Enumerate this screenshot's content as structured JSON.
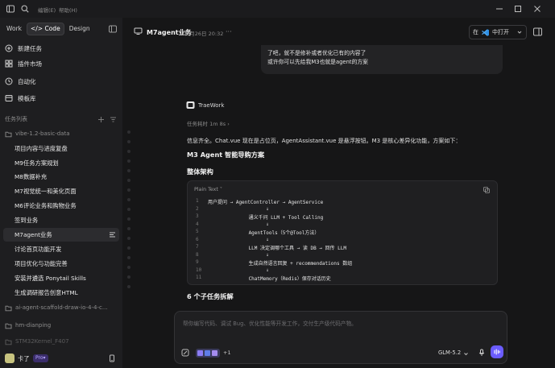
{
  "titlebar": {
    "menu_items": [
      "编辑(E)",
      "帮助(H)"
    ],
    "window_controls": [
      "minimize-icon",
      "maximize-icon",
      "close-icon"
    ]
  },
  "sidebar": {
    "modes": [
      {
        "label": "Work",
        "active": false
      },
      {
        "label": "</> Code",
        "active": true
      },
      {
        "label": "Design",
        "active": false
      }
    ],
    "nav": [
      {
        "label": "新建任务",
        "icon": "new-task-icon"
      },
      {
        "label": "插件市场",
        "icon": "plugin-icon"
      },
      {
        "label": "自动化",
        "icon": "automation-icon"
      },
      {
        "label": "模板库",
        "icon": "template-icon"
      }
    ],
    "section_label": "任务列表",
    "groups": [
      {
        "label": "vibe-1.2-basic-data"
      },
      {
        "label": "ai-agent-scaffold-draw-io-4-4-c..."
      },
      {
        "label": "hm-dianping"
      },
      {
        "label": "STM32Kernel_F407"
      }
    ],
    "tasks": [
      {
        "label": "项目内容与进度复盘",
        "active": false
      },
      {
        "label": "M9任务方案规划",
        "active": false
      },
      {
        "label": "M8数据补充",
        "active": false
      },
      {
        "label": "M7视觉统一和美化页面",
        "active": false
      },
      {
        "label": "M6评论业务和购物业务",
        "active": false
      },
      {
        "label": "签到业务",
        "active": false
      },
      {
        "label": "M7agent业务",
        "active": true
      },
      {
        "label": "讨论首页功能开发",
        "active": false
      },
      {
        "label": "项目优化与功能完善",
        "active": false
      },
      {
        "label": "安装并遴选 Ponytail Skills",
        "active": false
      },
      {
        "label": "生成调研报告创意HTML",
        "active": false
      }
    ],
    "user": {
      "name": "卡了",
      "badge": "Pro"
    }
  },
  "header": {
    "title": "M7agent业务",
    "date": "07月26日 20:32",
    "more": "···",
    "open_prefix": "在",
    "open_label": "中打开"
  },
  "chat": {
    "user_message_lines": [
      "了吧，就不是修补或者优化已有的内容了",
      "或许你可以先给我M3也就是agent的方案"
    ],
    "agent_name": "TraeWork",
    "task_time": "任务耗时 1m 8s ›",
    "intro": "信息齐全。Chat.vue 现在是占位页，AgentAssistant.vue 是悬浮按钮。M3 是核心差异化功能，方案如下：",
    "heading1": "M3 Agent 智能导购方案",
    "heading2": "整体架构",
    "code": {
      "lang": "Plain Text ˅",
      "lines": [
        {
          "n": "1",
          "t": "用户提问 → AgentController → AgentService"
        },
        {
          "n": "2",
          "t": "                    ↓"
        },
        {
          "n": "3",
          "t": "              通义千问 LLM + Tool Calling"
        },
        {
          "n": "4",
          "t": "                    ↓"
        },
        {
          "n": "5",
          "t": "              AgentTools（5个@Tool方法）"
        },
        {
          "n": "6",
          "t": "                    ↓"
        },
        {
          "n": "7",
          "t": "              LLM 决定调哪个工具 → 读 DB → 回传 LLM"
        },
        {
          "n": "8",
          "t": "                    ↓"
        },
        {
          "n": "9",
          "t": "              生成自然语言回复 + recommendations 数组"
        },
        {
          "n": "10",
          "t": "                    ↓"
        },
        {
          "n": "11",
          "t": "              ChatMemory（Redis）保存对话历史"
        }
      ]
    },
    "heading3": "6 个子任务拆解"
  },
  "input": {
    "placeholder": "帮你编写代码、调试 Bug、优化性能等开发工作，交付生产级代码产物。",
    "attach_count": "+1",
    "model": "GLM-5.2"
  },
  "colors": {
    "accent": "#6b5cff",
    "vscode": "#2d8fe6",
    "pro_badge": "#3a2d6b"
  }
}
